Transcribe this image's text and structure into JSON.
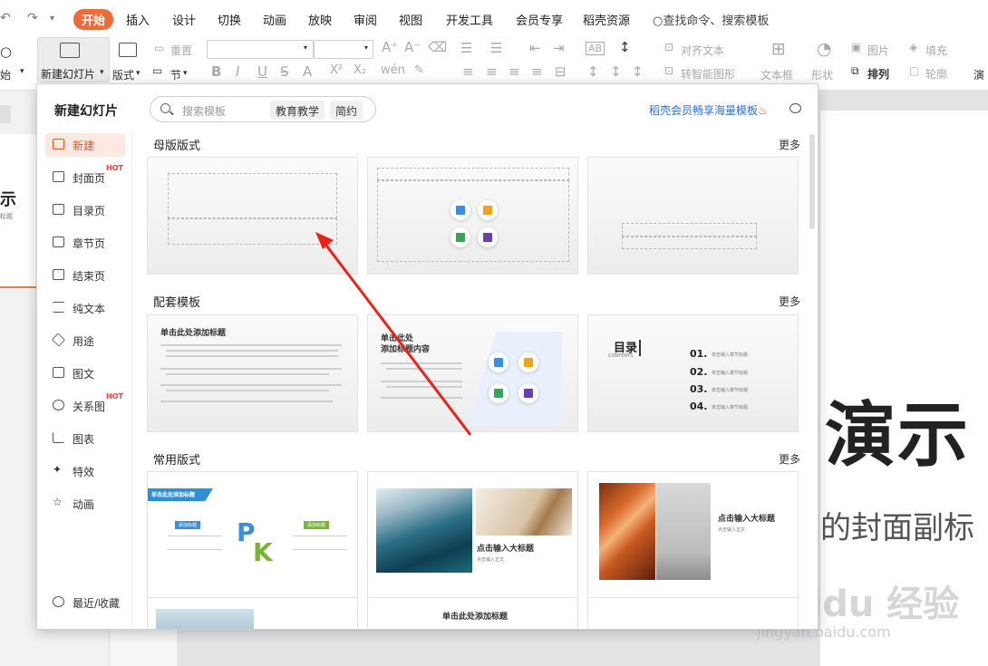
{
  "menubar": {
    "tabs": [
      {
        "label": "开始"
      },
      {
        "label": "插入"
      },
      {
        "label": "设计"
      },
      {
        "label": "切换"
      },
      {
        "label": "动画"
      },
      {
        "label": "放映"
      },
      {
        "label": "审阅"
      },
      {
        "label": "视图"
      },
      {
        "label": "开发工具"
      },
      {
        "label": "会员专享"
      },
      {
        "label": "稻壳资源"
      }
    ],
    "command_search": "查找命令、搜索模板"
  },
  "ribbon": {
    "new_slide": "新建幻灯片",
    "layout": "版式",
    "section": "节",
    "reset": "重置",
    "start_cut": "始",
    "align_text": "对齐文本",
    "smart_shape": "转智能图形",
    "textbox": "文本框",
    "shape": "形状",
    "picture": "图片",
    "fill": "填充",
    "arrange": "排列",
    "outline": "轮廓",
    "play_cut": "演",
    "bold": "B",
    "italic": "I",
    "underline": "U",
    "strike": "S",
    "superscript": "X²",
    "subscript": "X₂"
  },
  "popup": {
    "title": "新建幻灯片",
    "search_placeholder": "搜索模板",
    "chips": [
      "教育教学",
      "简约"
    ],
    "promo": "稻壳会员畅享海量模板",
    "sidebar": [
      {
        "label": "新建",
        "hot": false,
        "active": true
      },
      {
        "label": "封面页",
        "hot": true
      },
      {
        "label": "目录页",
        "hot": false
      },
      {
        "label": "章节页",
        "hot": false
      },
      {
        "label": "结束页",
        "hot": false
      },
      {
        "label": "纯文本",
        "hot": false
      },
      {
        "label": "用途",
        "hot": false
      },
      {
        "label": "图文",
        "hot": false
      },
      {
        "label": "关系图",
        "hot": true
      },
      {
        "label": "图表",
        "hot": false
      },
      {
        "label": "特效",
        "hot": false
      },
      {
        "label": "动画",
        "hot": false
      }
    ],
    "recent": "最近/收藏",
    "hot_badge": "HOT",
    "sections": [
      {
        "title": "母版版式",
        "more": "更多"
      },
      {
        "title": "配套模板",
        "more": "更多"
      },
      {
        "title": "常用版式",
        "more": "更多"
      }
    ],
    "cards": {
      "t1_title": "单击此处添加标题",
      "t2_title_line1": "单击此处",
      "t2_title_line2": "添加标题内容",
      "t3_title": "目录",
      "t3_sub": "CONTENTS",
      "t3_items": [
        "01.",
        "02.",
        "03.",
        "04."
      ],
      "t3_item_text": "单击输入章节标题",
      "c1_banner": "单击此处添加标题",
      "c1_label_a": "添加标题",
      "c1_label_b": "添加标题",
      "c2_title": "点击输入大标题",
      "c2_sub": "点击输入正文",
      "c3_title": "点击输入大标题",
      "c3_sub": "点击输入正文",
      "r4_title": "单击此处添加标题"
    }
  },
  "slide": {
    "title": "演示",
    "subtitle": "的封面副标",
    "left_title": "示",
    "left_sub": "标题"
  },
  "watermark": {
    "line1": "Baidu 经验",
    "line2": "jingyan.baidu.com"
  }
}
